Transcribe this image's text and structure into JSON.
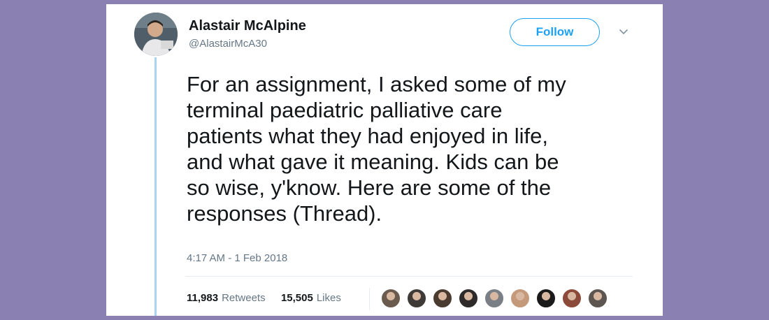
{
  "author": {
    "name": "Alastair McAlpine",
    "handle": "@AlastairMcA30"
  },
  "follow_label": "Follow",
  "icons": {
    "avatar": "profile-photo",
    "more": "chevron-down-icon"
  },
  "tweet": {
    "text": "For an assignment, I asked some of my\nterminal paediatric palliative care\npatients what they had enjoyed in life,\nand what gave it meaning. Kids can be\nso wise, y'know. Here are some of the\nresponses (Thread).",
    "timestamp": "4:17 AM - 1 Feb 2018"
  },
  "stats": {
    "retweets_count": "11,983",
    "retweets_label": "Retweets",
    "likes_count": "15,505",
    "likes_label": "Likes"
  },
  "likers": [
    {
      "color": "#6b5a4e"
    },
    {
      "color": "#3e3a38"
    },
    {
      "color": "#4a3b30"
    },
    {
      "color": "#2f2a2a"
    },
    {
      "color": "#7a7f86"
    },
    {
      "color": "#c49a7a"
    },
    {
      "color": "#1a1a1a"
    },
    {
      "color": "#8c4a3a"
    },
    {
      "color": "#5c5550"
    }
  ],
  "colors": {
    "background": "#8a80b1",
    "accent": "#1da1f2",
    "thread_line": "#a8d4f0",
    "muted_text": "#657786"
  }
}
